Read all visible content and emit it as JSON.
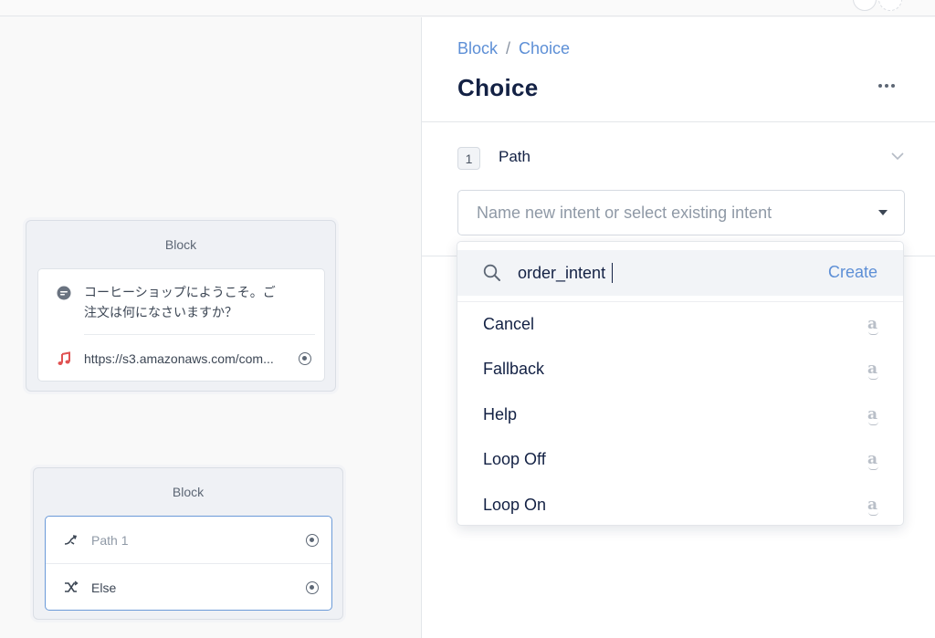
{
  "canvas": {
    "block1": {
      "title": "Block",
      "steps": [
        {
          "icon": "speech-bubble-icon",
          "text": "コーヒーショップにようこそ。ご注文は何になさいますか？"
        },
        {
          "icon": "music-note-icon",
          "text": "https://s3.amazonaws.com/com..."
        }
      ]
    },
    "block2": {
      "title": "Block",
      "steps": [
        {
          "icon": "path-branch-icon",
          "text": "Path 1"
        },
        {
          "icon": "shuffle-icon",
          "text": "Else"
        }
      ]
    }
  },
  "panel": {
    "breadcrumb": {
      "parent": "Block",
      "separator": "/",
      "current": "Choice"
    },
    "title": "Choice",
    "path": {
      "number": "1",
      "label": "Path",
      "select_placeholder": "Name new intent or select existing intent"
    },
    "dropdown": {
      "search_value": "order_intent",
      "create_label": "Create",
      "items": [
        {
          "label": "Cancel",
          "badge": "a"
        },
        {
          "label": "Fallback",
          "badge": "a"
        },
        {
          "label": "Help",
          "badge": "a"
        },
        {
          "label": "Loop Off",
          "badge": "a"
        },
        {
          "label": "Loop On",
          "badge": "a"
        }
      ]
    }
  },
  "colors": {
    "accent": "#5d8fd6",
    "title": "#132144",
    "music_icon": "#e05252",
    "selected_border": "#6b9ad8"
  }
}
